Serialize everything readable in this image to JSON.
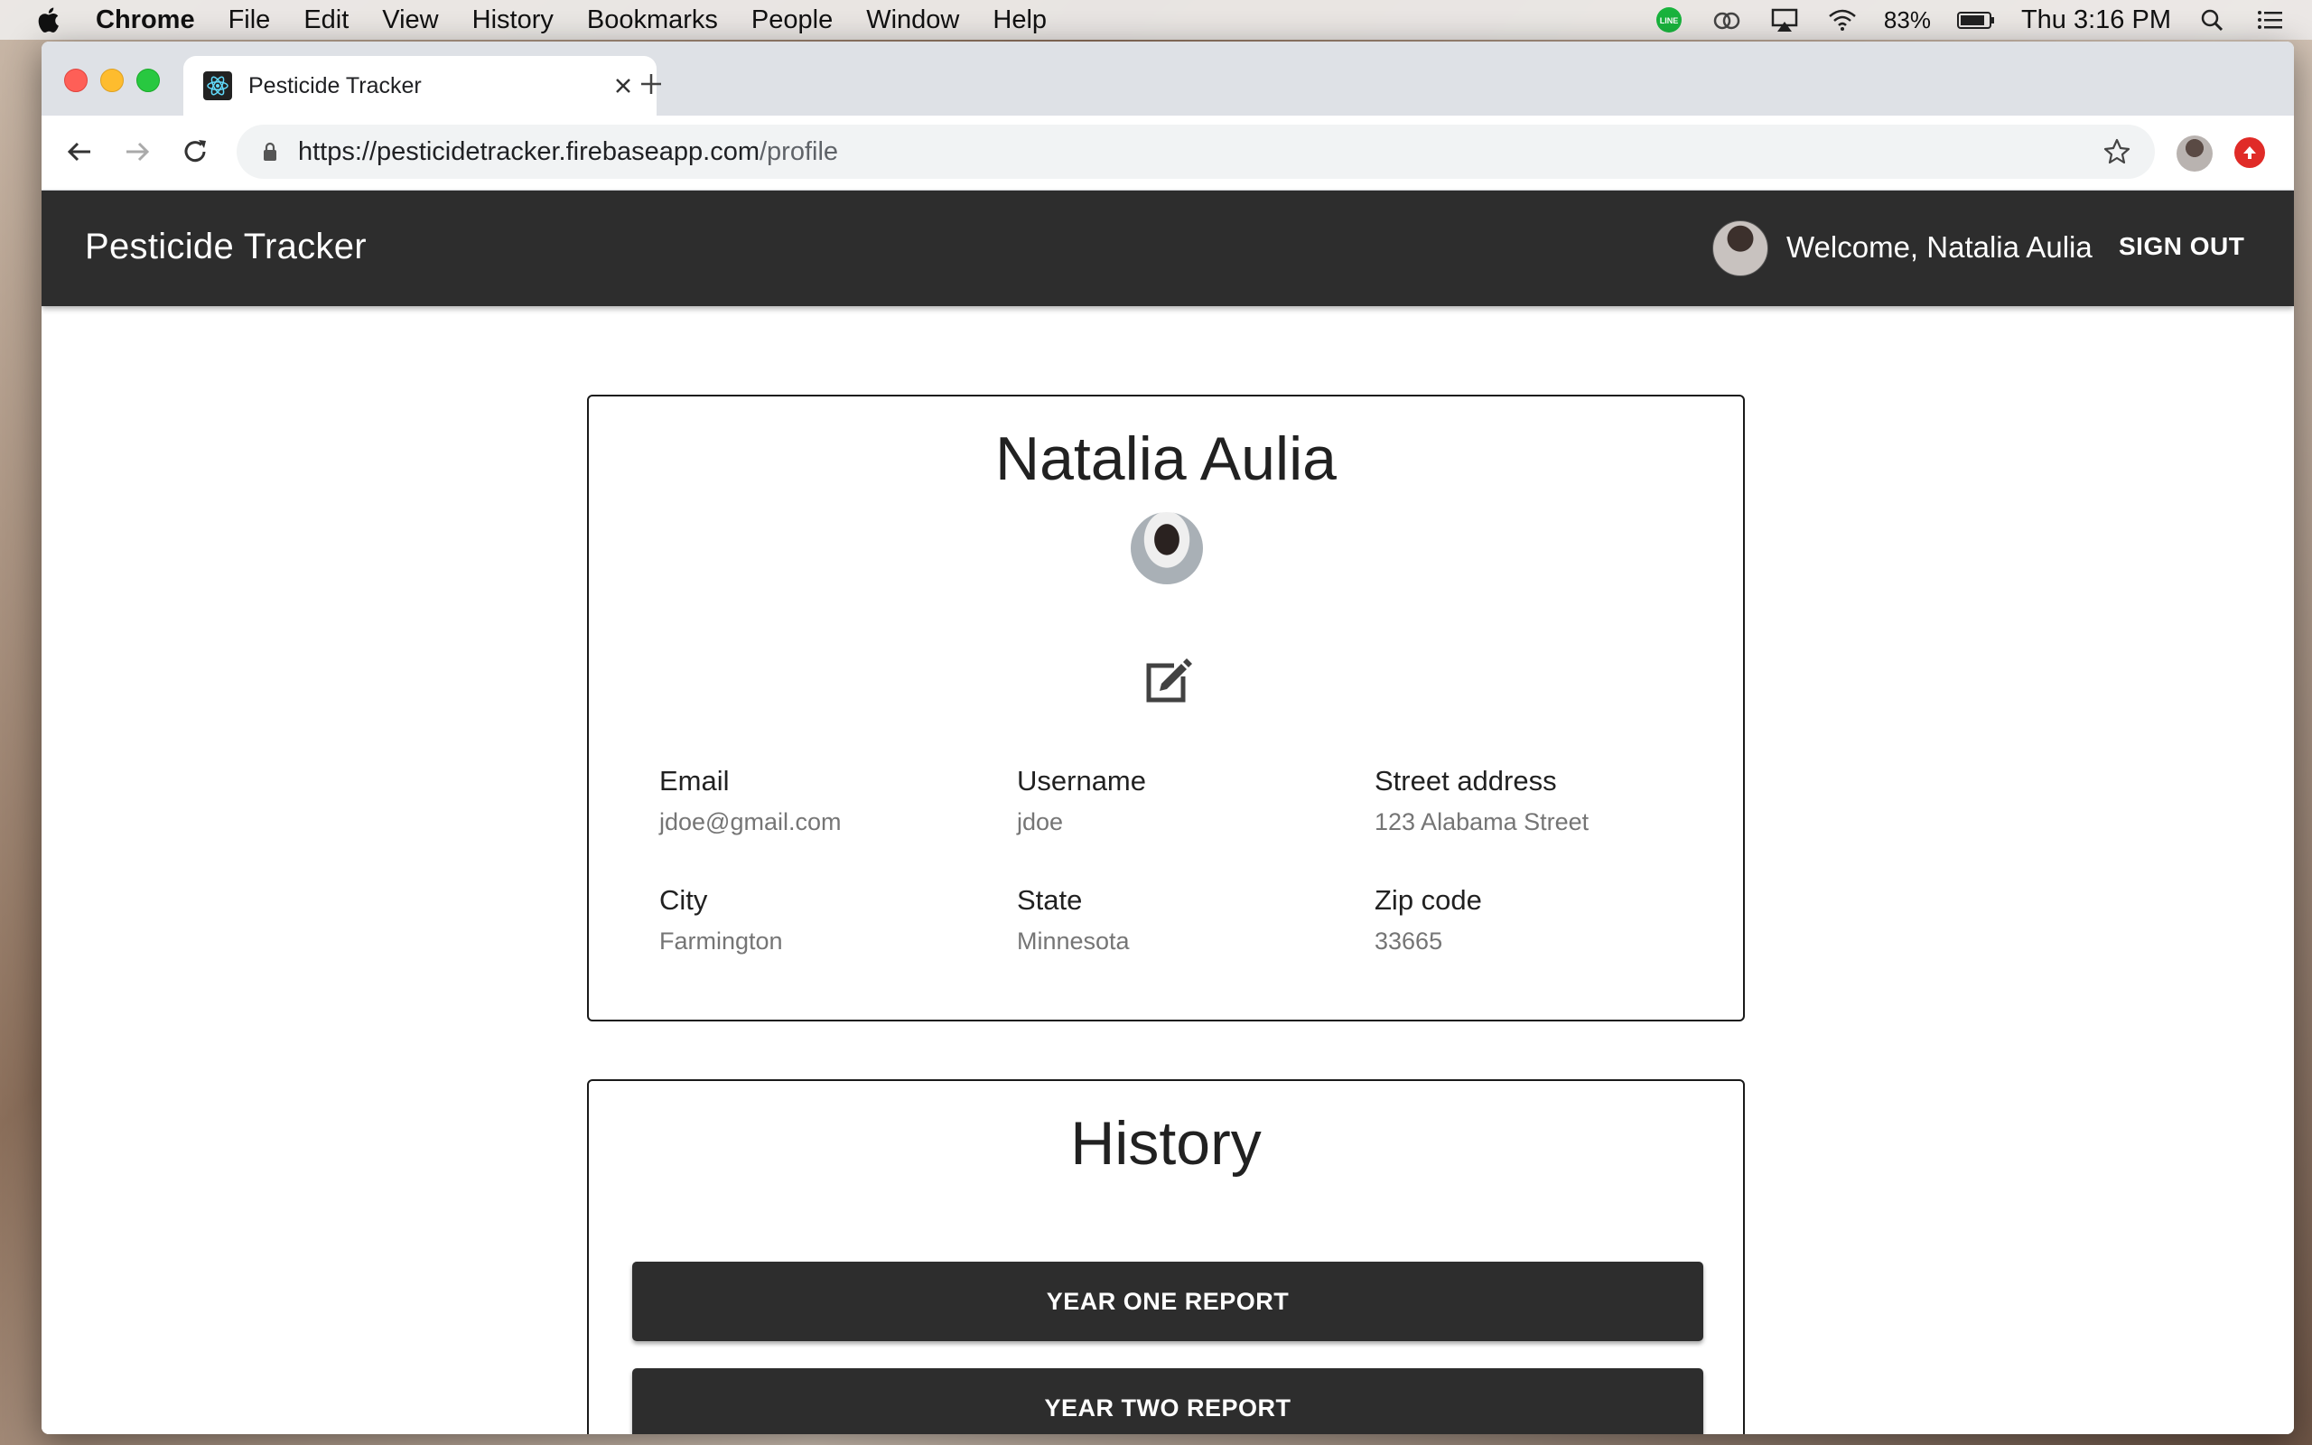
{
  "menubar": {
    "app_name": "Chrome",
    "items": [
      "File",
      "Edit",
      "View",
      "History",
      "Bookmarks",
      "People",
      "Window",
      "Help"
    ],
    "battery": "83%",
    "clock": "Thu 3:16 PM"
  },
  "browser": {
    "tab_title": "Pesticide Tracker",
    "url_host": "https://pesticidetracker.firebaseapp.com",
    "url_path": "/profile"
  },
  "appbar": {
    "brand": "Pesticide Tracker",
    "welcome": "Welcome, Natalia Aulia",
    "signout": "SIGN OUT"
  },
  "profile": {
    "name": "Natalia Aulia",
    "fields": [
      {
        "label": "Email",
        "value": "jdoe@gmail.com"
      },
      {
        "label": "Username",
        "value": "jdoe"
      },
      {
        "label": "Street address",
        "value": "123 Alabama Street"
      },
      {
        "label": "City",
        "value": "Farmington"
      },
      {
        "label": "State",
        "value": "Minnesota"
      },
      {
        "label": "Zip code",
        "value": "33665"
      }
    ]
  },
  "history": {
    "title": "History",
    "buttons": [
      "YEAR ONE REPORT",
      "YEAR TWO REPORT"
    ]
  }
}
